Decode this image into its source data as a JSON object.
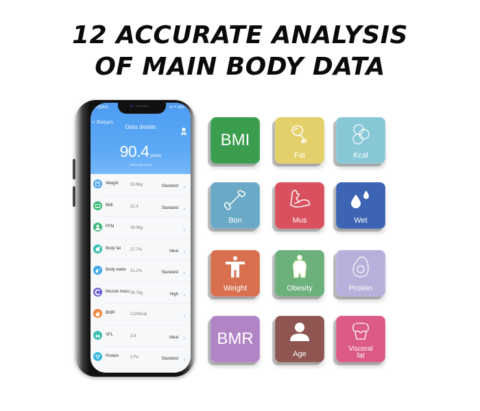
{
  "headline": {
    "line1": "12 ACCURATE ANALYSIS",
    "line2": "OF MAIN BODY DATA"
  },
  "phone": {
    "status_left": "中国电信",
    "status_right": "⊕ ☂ 96%",
    "back_label": "< Return",
    "title": "Data details",
    "score": "90.4",
    "score_unit": "points",
    "score_caption": "Your body score",
    "rows": [
      {
        "name": "Weight",
        "value": "53.6kg",
        "status": "Standard",
        "icon": "scale-icon",
        "color": "#4aa3ef"
      },
      {
        "name": "BMI",
        "value": "22.4",
        "status": "Standard",
        "icon": "bmi-icon",
        "color": "#3fb877"
      },
      {
        "name": "FFM",
        "value": "38.9kg",
        "status": "",
        "icon": "person-icon",
        "color": "#3fb877"
      },
      {
        "name": "Body fat",
        "value": "27.7%",
        "status": "Ideal",
        "icon": "body-fat-icon",
        "color": "#33c0ad"
      },
      {
        "name": "Body water",
        "value": "51.2%",
        "status": "Standard",
        "icon": "water-drop-icon",
        "color": "#3aa6ec"
      },
      {
        "name": "Muscle mass",
        "value": "36.7kg",
        "status": "High",
        "icon": "muscle-icon",
        "color": "#6b5ed8"
      },
      {
        "name": "BMR",
        "value": "1220kcal",
        "status": "",
        "icon": "flame-icon",
        "color": "#f0843a"
      },
      {
        "name": "VFL",
        "value": "3.9",
        "status": "Ideal",
        "icon": "lungs-icon",
        "color": "#3cc0b0"
      },
      {
        "name": "Protein",
        "value": "17%",
        "status": "Standard",
        "icon": "molecule-icon",
        "color": "#3cb8e0"
      }
    ],
    "chevron": "›"
  },
  "tiles": [
    {
      "label": "BMI",
      "big": true,
      "icon": "bmi-text",
      "color": "#3a9e4e"
    },
    {
      "label": "Fat",
      "big": false,
      "icon": "drumstick-icon",
      "color": "#e3d06a"
    },
    {
      "label": "Kcal",
      "big": false,
      "icon": "circles-icon",
      "color": "#88c8d6"
    },
    {
      "label": "Bon",
      "big": false,
      "icon": "bone-icon",
      "color": "#6aaac6"
    },
    {
      "label": "Mus",
      "big": false,
      "icon": "flexed-arm-icon",
      "color": "#d9505e"
    },
    {
      "label": "Wet",
      "big": false,
      "icon": "water-drops-icon",
      "color": "#3d63b3"
    },
    {
      "label": "Weight",
      "big": false,
      "icon": "person-arms-out-icon",
      "color": "#d8704f"
    },
    {
      "label": "Obesity",
      "big": false,
      "icon": "obese-person-icon",
      "color": "#6cb07c"
    },
    {
      "label": "Prolein",
      "big": false,
      "icon": "egg-icon",
      "color": "#b7b0da"
    },
    {
      "label": "BMR",
      "big": true,
      "icon": "bmr-text",
      "color": "#b184c6"
    },
    {
      "label": "Age",
      "big": false,
      "icon": "user-silhouette-icon",
      "color": "#8e5551"
    },
    {
      "label": "Visceral fat",
      "big": false,
      "icon": "torso-icon",
      "color": "#dc5a86"
    }
  ]
}
